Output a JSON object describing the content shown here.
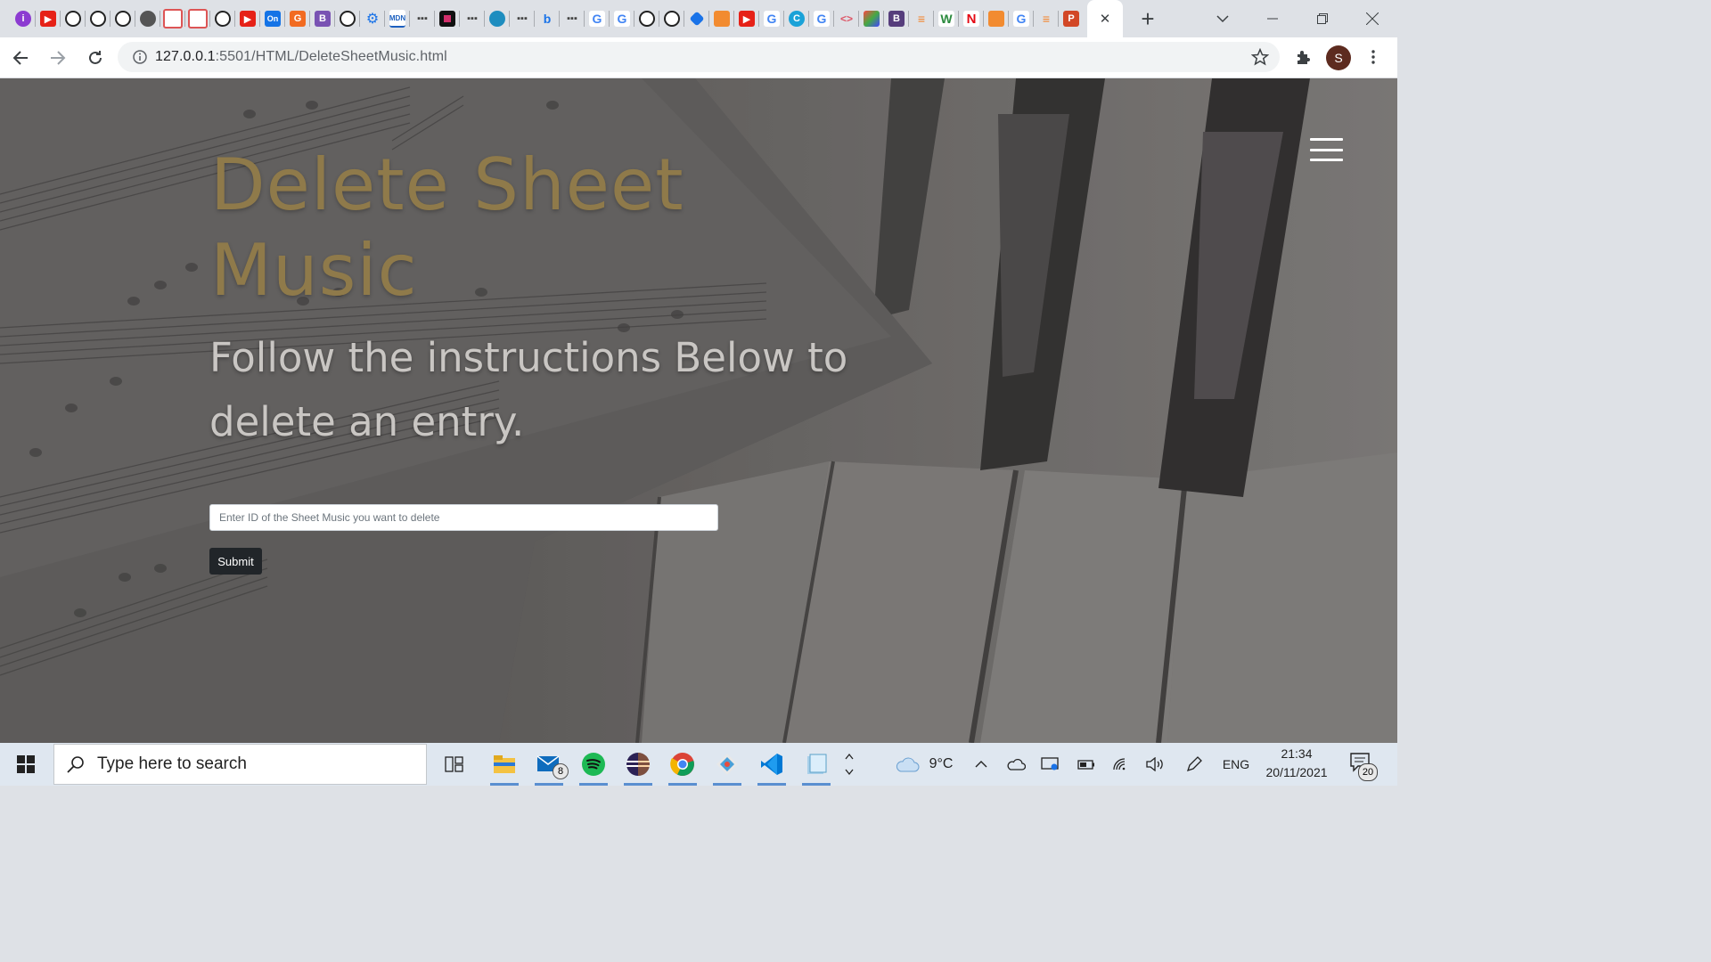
{
  "browser": {
    "tab_close_label": "✕",
    "new_tab_label": "+",
    "address_bar": {
      "host": "127.0.0.1",
      "rest": ":5501/HTML/DeleteSheetMusic.html"
    },
    "profile_initial": "S"
  },
  "page": {
    "title": "Delete Sheet Music",
    "subtitle": "Follow the instructions Below to delete an entry.",
    "id_input": {
      "placeholder": "Enter ID of the Sheet Music you want to delete",
      "value": ""
    },
    "submit_label": "Submit"
  },
  "taskbar": {
    "search_placeholder": "Type here to search",
    "mail_badge": "8",
    "weather_temp": "9°C",
    "language": "ENG",
    "time": "21:34",
    "date": "20/11/2021",
    "notification_count": "20"
  }
}
